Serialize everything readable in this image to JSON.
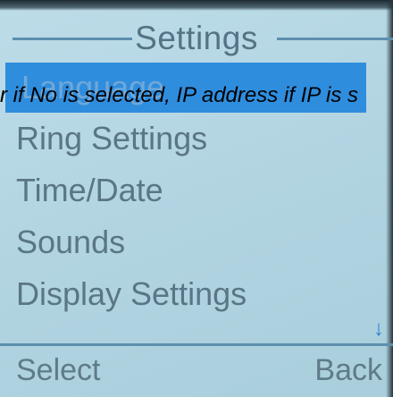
{
  "screen": {
    "title": "Settings",
    "overlay_text": "r if No is selected, IP address if IP is s"
  },
  "menu": {
    "items": [
      {
        "label": "Language",
        "selected": true
      },
      {
        "label": "Ring Settings",
        "selected": false
      },
      {
        "label": "Time/Date",
        "selected": false
      },
      {
        "label": "Sounds",
        "selected": false
      },
      {
        "label": "Display Settings",
        "selected": false
      }
    ],
    "scroll_icon": "down-arrow-icon",
    "scroll_glyph": "↓"
  },
  "softkeys": {
    "left_label": "Select",
    "right_label": "Back"
  },
  "colors": {
    "background": "#b3d5e2",
    "highlight": "#2f8dde",
    "text": "#5a7686",
    "divider": "#5d8fae"
  }
}
